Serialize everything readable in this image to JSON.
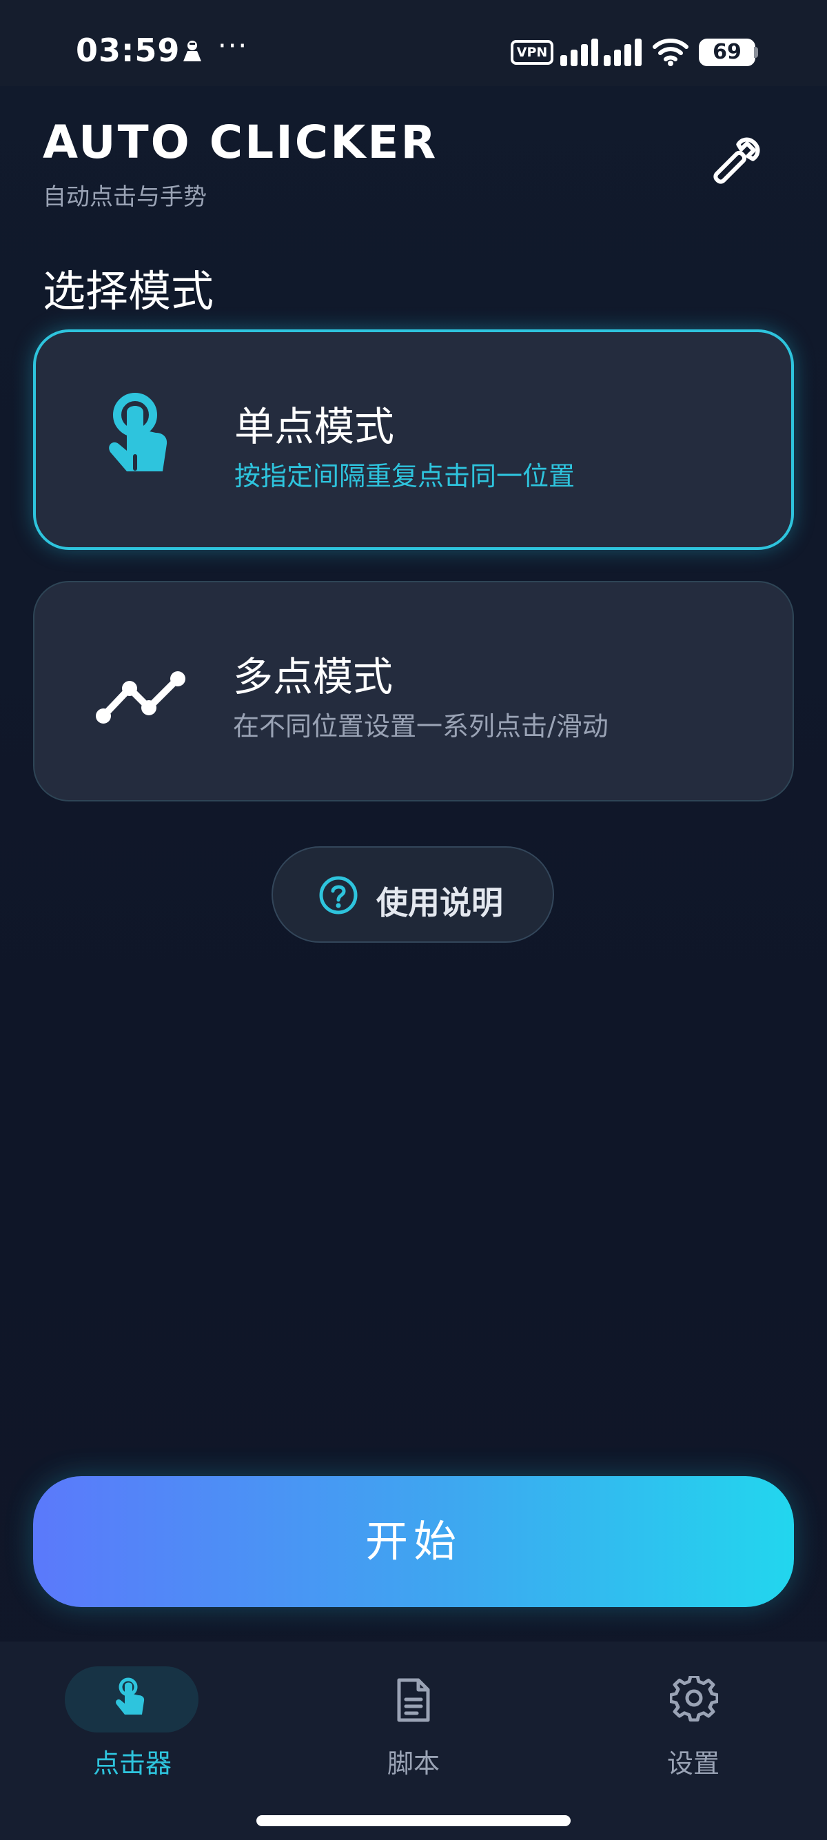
{
  "status_bar": {
    "time": "03:59",
    "overflow": "···",
    "vpn": "VPN",
    "battery": "69",
    "icons": [
      "person-icon",
      "signal-icon",
      "wifi-icon",
      "battery-icon"
    ]
  },
  "header": {
    "title": "AUTO CLICKER",
    "subtitle": "自动点击与手势",
    "tool_icon": "wrench-icon"
  },
  "section_title": "选择模式",
  "modes": [
    {
      "title": "单点模式",
      "description": "按指定间隔重复点击同一位置",
      "icon": "tap-hand-icon",
      "selected": true
    },
    {
      "title": "多点模式",
      "description": "在不同位置设置一系列点击/滑动",
      "icon": "multi-point-path-icon",
      "selected": false
    }
  ],
  "help": {
    "label": "使用说明",
    "icon": "question-circle-icon"
  },
  "start_label": "开始",
  "nav": [
    {
      "label": "点击器",
      "icon": "tap-hand-icon",
      "active": true
    },
    {
      "label": "脚本",
      "icon": "document-icon",
      "active": false
    },
    {
      "label": "设置",
      "icon": "gear-icon",
      "active": false
    }
  ],
  "colors": {
    "accent": "#2ec4dd",
    "background": "#10162a",
    "card": "#242c3e",
    "start_gradient_from": "#5b79fb",
    "start_gradient_to": "#22d6ee"
  }
}
